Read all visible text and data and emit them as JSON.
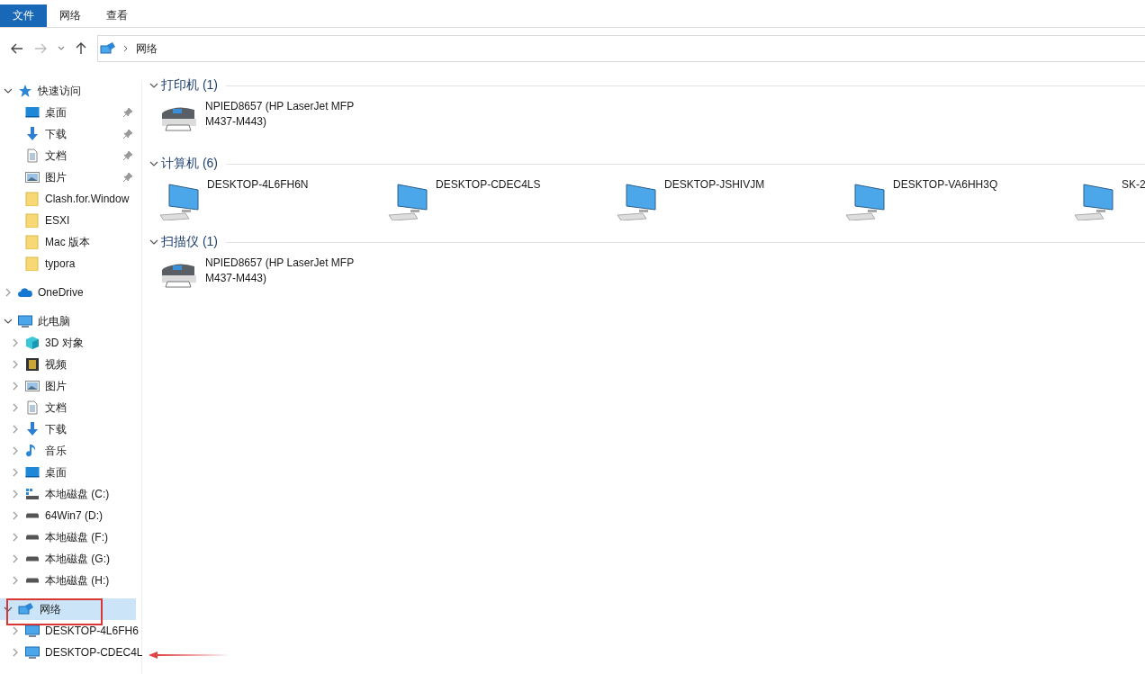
{
  "ribbon_tabs": [
    {
      "label": "文件",
      "selected": true
    },
    {
      "label": "网络",
      "selected": false
    },
    {
      "label": "查看",
      "selected": false
    }
  ],
  "address_bar": {
    "path": [
      "网络"
    ]
  },
  "nav": [
    {
      "kind": "star",
      "label": "快速访问",
      "expanded": true,
      "selected": false,
      "children": [
        {
          "kind": "desktop",
          "label": "桌面",
          "pinned": true,
          "selected": false
        },
        {
          "kind": "download",
          "label": "下载",
          "pinned": true,
          "selected": false
        },
        {
          "kind": "docs",
          "label": "文档",
          "pinned": true,
          "selected": false
        },
        {
          "kind": "pictures",
          "label": "图片",
          "pinned": true,
          "selected": false
        },
        {
          "kind": "folder",
          "label": "Clash.for.Window",
          "pinned": false,
          "selected": false
        },
        {
          "kind": "folder",
          "label": "ESXI",
          "pinned": false,
          "selected": false
        },
        {
          "kind": "folder",
          "label": "Mac 版本",
          "pinned": false,
          "selected": false
        },
        {
          "kind": "folder",
          "label": "typora",
          "pinned": false,
          "selected": false
        }
      ]
    },
    {
      "kind": "cloud",
      "label": "OneDrive",
      "expanded": false,
      "selected": false
    },
    {
      "kind": "pc",
      "label": "此电脑",
      "expanded": true,
      "selected": false,
      "children": [
        {
          "kind": "cube",
          "label": "3D 对象",
          "expanded": false,
          "selected": false
        },
        {
          "kind": "video",
          "label": "视频",
          "expanded": false,
          "selected": false
        },
        {
          "kind": "pictures",
          "label": "图片",
          "expanded": false,
          "selected": false
        },
        {
          "kind": "docs",
          "label": "文档",
          "expanded": false,
          "selected": false
        },
        {
          "kind": "download",
          "label": "下载",
          "expanded": false,
          "selected": false
        },
        {
          "kind": "music",
          "label": "音乐",
          "expanded": false,
          "selected": false
        },
        {
          "kind": "desktop",
          "label": "桌面",
          "expanded": false,
          "selected": false
        },
        {
          "kind": "osdrive",
          "label": "本地磁盘 (C:)",
          "expanded": false,
          "selected": false
        },
        {
          "kind": "drive",
          "label": "64Win7  (D:)",
          "expanded": false,
          "selected": false
        },
        {
          "kind": "drive",
          "label": "本地磁盘 (F:)",
          "expanded": false,
          "selected": false
        },
        {
          "kind": "drive",
          "label": "本地磁盘 (G:)",
          "expanded": false,
          "selected": false
        },
        {
          "kind": "drive",
          "label": "本地磁盘 (H:)",
          "expanded": false,
          "selected": false
        }
      ]
    },
    {
      "kind": "network",
      "label": "网络",
      "expanded": true,
      "selected": true,
      "children": [
        {
          "kind": "monitor",
          "label": "DESKTOP-4L6FH6",
          "expanded": false,
          "selected": false
        },
        {
          "kind": "monitor",
          "label": "DESKTOP-CDEC4L",
          "expanded": false,
          "selected": false
        }
      ]
    }
  ],
  "groups": [
    {
      "title": "打印机 (1)",
      "expanded": true,
      "items": [
        {
          "kind": "printer",
          "name": "NPIED8657 (HP LaserJet MFP M437-M443)"
        }
      ]
    },
    {
      "title": "计算机 (6)",
      "expanded": true,
      "items": [
        {
          "kind": "computer",
          "name": "DESKTOP-4L6FH6N"
        },
        {
          "kind": "computer",
          "name": "DESKTOP-CDEC4LS"
        },
        {
          "kind": "computer",
          "name": "DESKTOP-JSHIVJM"
        },
        {
          "kind": "computer",
          "name": "DESKTOP-VA6HH3Q"
        },
        {
          "kind": "computer",
          "name": "SK-2"
        }
      ]
    },
    {
      "title": "扫描仪 (1)",
      "expanded": true,
      "items": [
        {
          "kind": "printer",
          "name": "NPIED8657 (HP LaserJet MFP M437-M443)"
        }
      ]
    }
  ]
}
